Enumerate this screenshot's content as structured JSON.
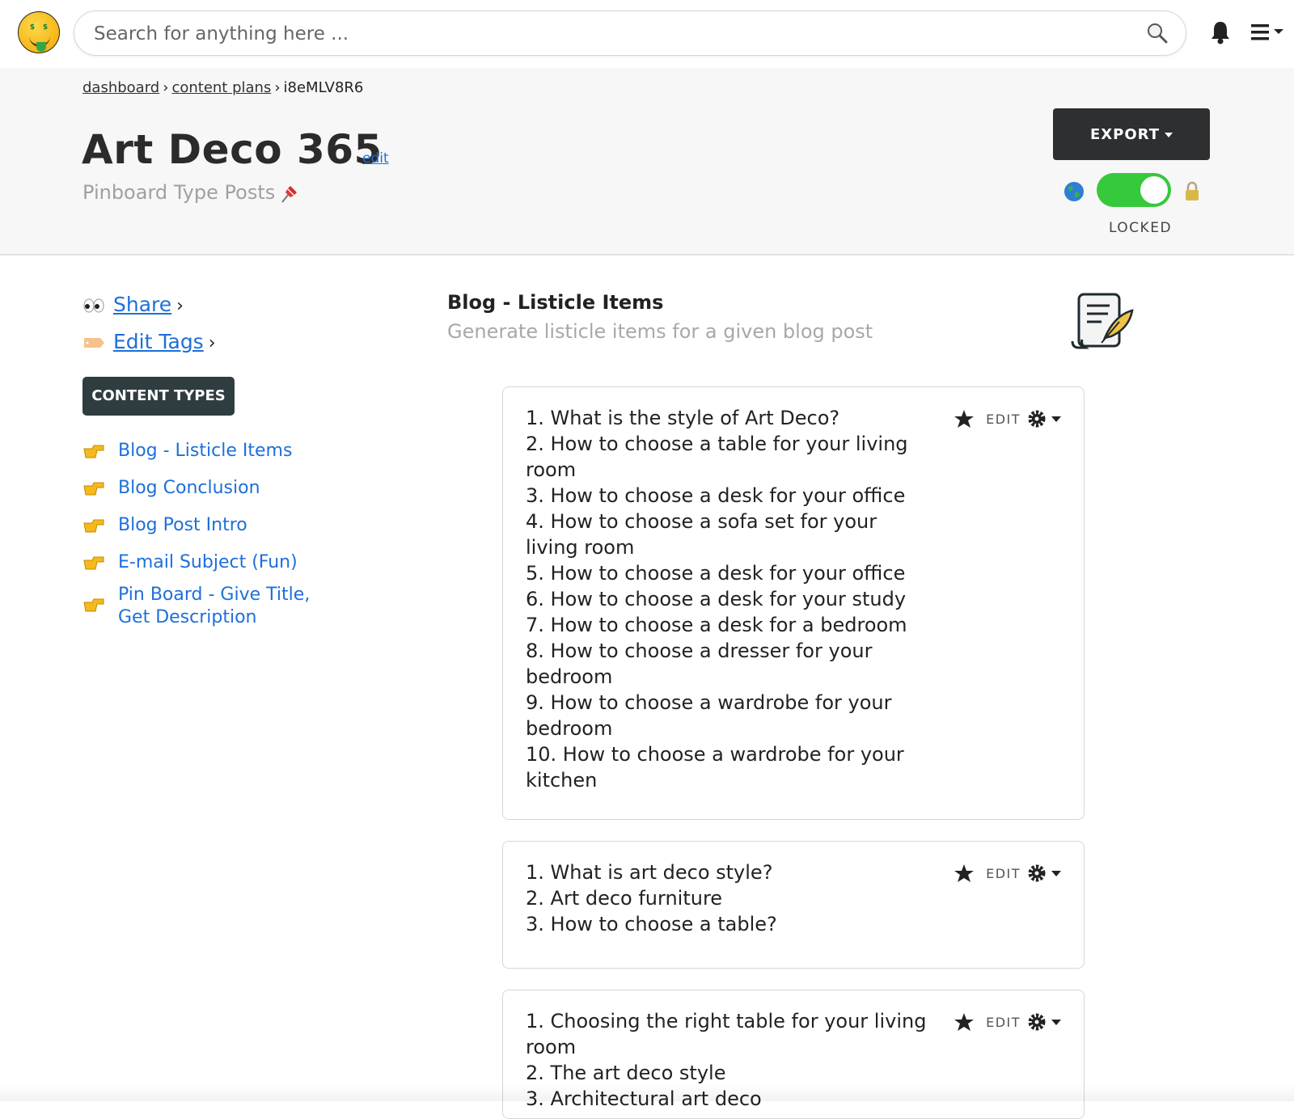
{
  "topbar": {
    "search_placeholder": "Search for anything here ..."
  },
  "breadcrumb": {
    "items": [
      "dashboard",
      "content plans"
    ],
    "current": "i8eMLV8R6"
  },
  "header": {
    "title": "Art Deco 365",
    "edit_label": "edit",
    "subtitle": "Pinboard Type Posts",
    "export_label": "EXPORT",
    "lock_status": "LOCKED",
    "toggle_on": true
  },
  "sidebar": {
    "share_label": "Share",
    "edit_tags_label": "Edit Tags",
    "content_types_label": "CONTENT TYPES",
    "items": [
      "Blog - Listicle Items",
      "Blog Conclusion",
      "Blog Post Intro",
      "E-mail Subject (Fun)",
      "Pin Board - Give Title, Get Description"
    ]
  },
  "main": {
    "title": "Blog - Listicle Items",
    "description": "Generate listicle items for a given blog post",
    "edit_label": "EDIT",
    "cards": [
      {
        "lines": [
          "1. What is the style of Art Deco?",
          "2. How to choose a table for your living room",
          "3. How to choose a desk for your office",
          "4. How to choose a sofa set for your living room",
          "5. How to choose a desk for your office",
          "6. How to choose a desk for your study",
          "7. How to choose a desk for a bedroom",
          "8. How to choose a dresser for your bedroom",
          "9. How to choose a wardrobe for your bedroom",
          "10. How to choose a wardrobe for your kitchen"
        ]
      },
      {
        "lines": [
          "1. What is art deco style?",
          "2. Art deco furniture",
          "3. How to choose a table?"
        ]
      },
      {
        "lines": [
          "1. Choosing the right table for your living room",
          "2. The art deco style",
          "3. Architectural art deco"
        ]
      }
    ]
  },
  "colors": {
    "link": "#1e6fd9",
    "toggle_on": "#35c93b",
    "dark_button": "#2d2f31",
    "badge": "#2f3d40"
  }
}
